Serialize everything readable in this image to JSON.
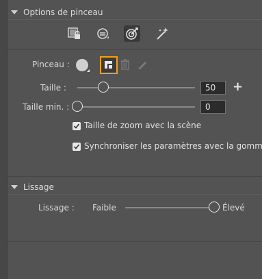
{
  "brush_options": {
    "header": "Options de pinceau",
    "modes": [
      {
        "icon": "locked-layer-icon",
        "active": false
      },
      {
        "icon": "brush-sync-icon",
        "active": false
      },
      {
        "icon": "target-brush-icon",
        "active": true
      },
      {
        "icon": "sparkle-wand-icon",
        "active": false
      }
    ],
    "brush_label": "Pinceau :",
    "size_label": "Taille :",
    "size_value": "50",
    "size_fraction": 0.22,
    "min_size_label": "Taille min. :",
    "min_size_value": "0",
    "min_size_fraction": 0.0,
    "zoom_checkbox_label": "Taille de zoom avec la scène",
    "zoom_checked": true,
    "sync_checkbox_label": "Synchroniser les paramètres avec la gomme",
    "sync_checked": true
  },
  "smoothing": {
    "header": "Lissage",
    "label": "Lissage :",
    "min_label": "Faible",
    "max_label": "Élevé",
    "value_fraction": 1.0
  }
}
